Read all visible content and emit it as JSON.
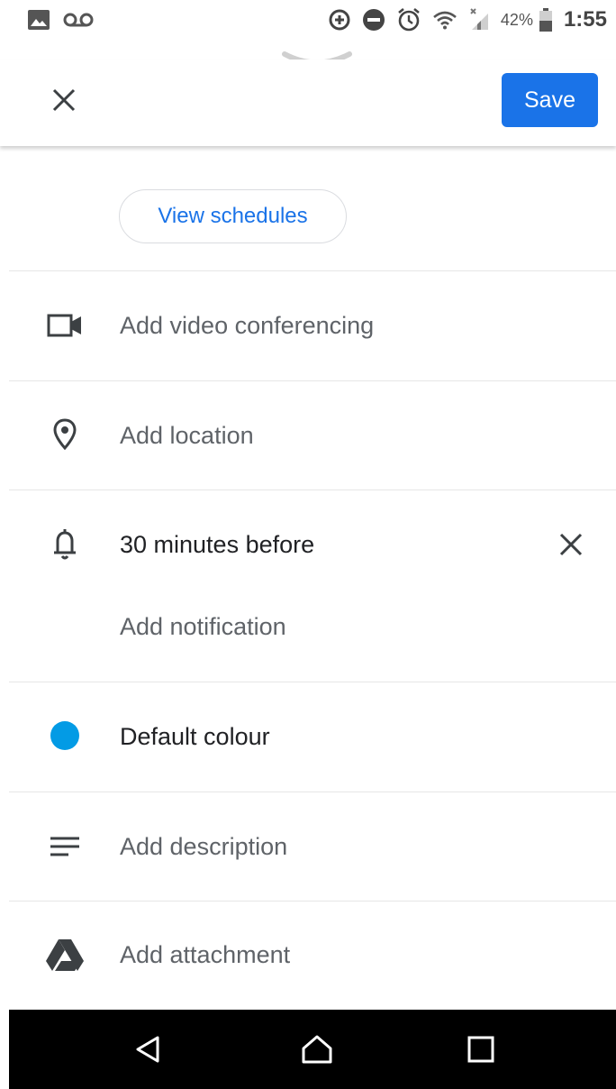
{
  "status_bar": {
    "battery_percent": "42%",
    "time": "1:55",
    "left_icons": [
      "image-icon",
      "voicemail-icon"
    ],
    "right_icons": [
      "data-saver-icon",
      "do-not-disturb-icon",
      "alarm-icon",
      "wifi-icon",
      "cell-signal-icon",
      "battery-icon"
    ]
  },
  "top_bar": {
    "save_label": "Save",
    "close_icon": "close-icon"
  },
  "view_schedules_label": "View schedules",
  "rows": {
    "video": {
      "label": "Add video conferencing",
      "icon": "video-camera-icon"
    },
    "location": {
      "label": "Add location",
      "icon": "location-pin-icon"
    },
    "notification": {
      "label": "30 minutes before",
      "icon": "bell-icon",
      "add_label": "Add notification"
    },
    "colour": {
      "label": "Default colour",
      "icon": "color-dot-icon",
      "color": "#039be5"
    },
    "description": {
      "label": "Add description",
      "icon": "notes-icon"
    },
    "attachment": {
      "label": "Add attachment",
      "icon": "drive-icon"
    }
  },
  "nav_bar": {
    "buttons": [
      "back-icon",
      "home-icon",
      "recents-icon"
    ]
  },
  "colors": {
    "accent": "#1a73e8",
    "text_secondary": "#5f6368",
    "text_primary": "#202124"
  }
}
